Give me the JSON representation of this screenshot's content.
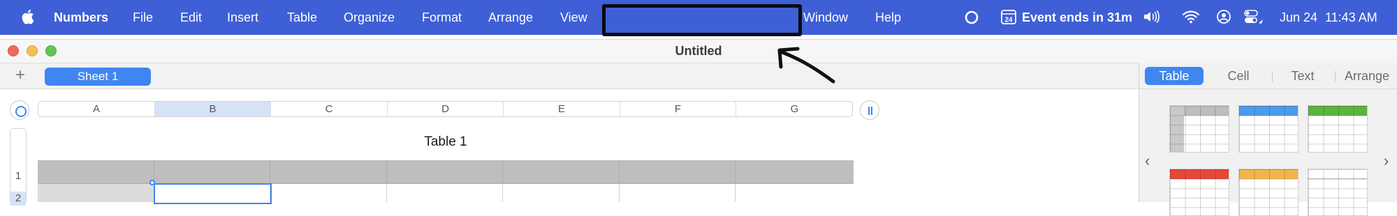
{
  "menubar": {
    "app_name": "Numbers",
    "items": [
      "File",
      "Edit",
      "Insert",
      "Table",
      "Organize",
      "Format",
      "Arrange",
      "View",
      "Window",
      "Help"
    ],
    "status": {
      "calendar_day": "24",
      "event_text": "Event ends in 31m",
      "date": "Jun 24",
      "time": "11:43 AM"
    }
  },
  "window": {
    "title": "Untitled"
  },
  "sheets": {
    "add_label": "+",
    "tabs": [
      "Sheet 1"
    ]
  },
  "spreadsheet": {
    "columns": [
      "A",
      "B",
      "C",
      "D",
      "E",
      "F",
      "G"
    ],
    "selected_column": "B",
    "rows": [
      "1",
      "2"
    ],
    "selected_row": "2",
    "table_title": "Table 1"
  },
  "inspector": {
    "tabs": [
      "Table",
      "Cell",
      "Text",
      "Arrange"
    ],
    "active_tab": "Table",
    "prev_label": "‹",
    "next_label": "›",
    "table_styles": [
      {
        "header": "#bdbdbd",
        "first_col": true
      },
      {
        "header": "#4a9bea",
        "first_col": false
      },
      {
        "header": "#5cb43d",
        "first_col": false
      },
      {
        "header": "#e5483b",
        "first_col": false
      },
      {
        "header": "#f0b54a",
        "first_col": false
      },
      {
        "header": "#ffffff",
        "first_col": false
      }
    ]
  },
  "colors": {
    "menubar": "#3e5fd6",
    "accent": "#3f86f0",
    "close": "#ed6a5e",
    "minimize": "#f5bf4f",
    "zoom": "#61c554"
  }
}
